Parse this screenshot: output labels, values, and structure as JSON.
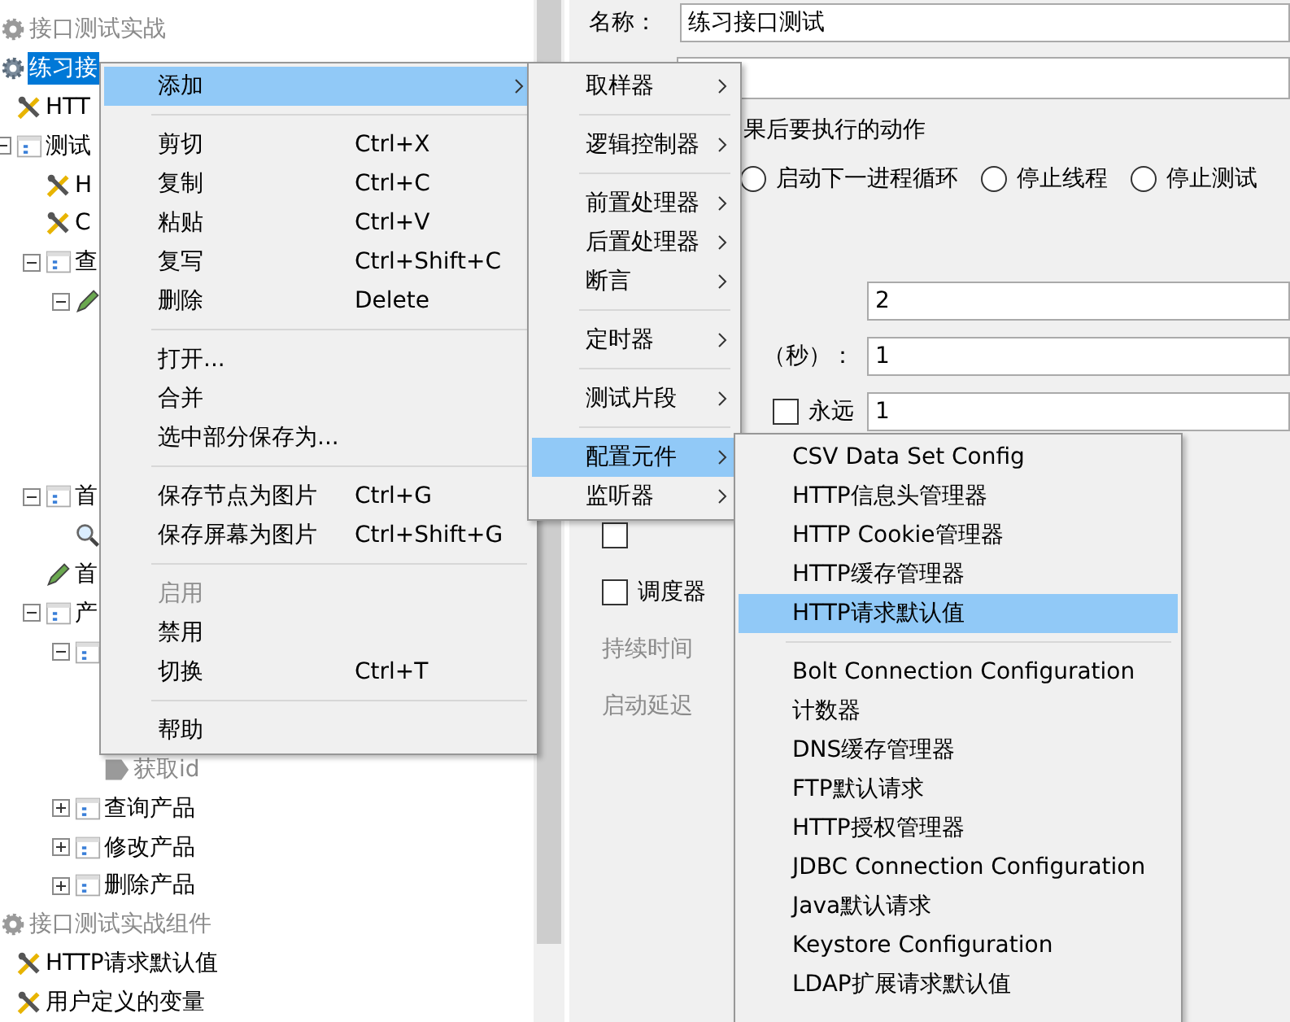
{
  "tree": [
    {
      "label": "接口测试实战",
      "kind": "plan",
      "disabled": true,
      "selected": false
    },
    {
      "label": "练习接",
      "kind": "plan",
      "disabled": false,
      "selected": true,
      "children": [
        {
          "label": "HTT",
          "kind": "config",
          "disabled": false,
          "selected": false
        },
        {
          "label": "测试",
          "kind": "group",
          "disabled": false,
          "selected": false,
          "expanded": true,
          "children": [
            {
              "label": "H",
              "kind": "config",
              "disabled": false,
              "selected": false
            },
            {
              "label": "C",
              "kind": "config",
              "disabled": false,
              "selected": false
            },
            {
              "label": "查",
              "kind": "group",
              "disabled": false,
              "selected": false,
              "expanded": true,
              "children": [
                {
                  "kind": "sampler",
                  "expanded": true
                }
              ]
            },
            {
              "label": "首",
              "kind": "group",
              "disabled": false,
              "selected": false,
              "expanded": true,
              "children": [
                {
                  "kind": "listener"
                }
              ]
            },
            {
              "label": "首",
              "kind": "sampler",
              "disabled": false,
              "selected": false
            },
            {
              "label": "产",
              "kind": "group",
              "disabled": false,
              "selected": false,
              "expanded": true,
              "children": [
                {
                  "kind": "group",
                  "expanded": true,
                  "children": [
                    {
                      "label": "获取id",
                      "kind": "extractor",
                      "disabled": true,
                      "selected": false
                    }
                  ]
                },
                {
                  "label": "查询产品",
                  "kind": "group",
                  "disabled": false,
                  "selected": false,
                  "expanded": false
                },
                {
                  "label": "修改产品",
                  "kind": "group",
                  "disabled": false,
                  "selected": false,
                  "expanded": false
                },
                {
                  "label": "删除产品",
                  "kind": "group",
                  "disabled": false,
                  "selected": false,
                  "expanded": false
                }
              ]
            }
          ]
        }
      ]
    },
    {
      "label": "接口测试实战组件",
      "kind": "plan",
      "disabled": true,
      "selected": false,
      "children": [
        {
          "label": "HTTP请求默认值",
          "kind": "config",
          "disabled": false,
          "selected": false
        },
        {
          "label": "用户定义的变量",
          "kind": "config",
          "disabled": false,
          "selected": false
        }
      ]
    }
  ],
  "editor": {
    "name_label": "名称：",
    "name_value": "练习接口测试",
    "action_group_title": "果后要执行的动作",
    "actions": [
      {
        "label": "启动下一进程循环",
        "selected": false
      },
      {
        "label": "停止线程",
        "selected": false
      },
      {
        "label": "停止测试",
        "selected": false
      }
    ],
    "fields": [
      {
        "value": "2"
      },
      {
        "label": "（秒）：",
        "value": "1"
      },
      {
        "checkbox_label": "永远",
        "checked": false,
        "value": "1"
      }
    ],
    "options": [
      {
        "kind": "checkbox",
        "checked": false
      },
      {
        "kind": "checkbox",
        "label": "调度器",
        "checked": false
      },
      {
        "kind": "text",
        "label": "持续时间",
        "disabled": true
      },
      {
        "kind": "text",
        "label": "启动延迟",
        "disabled": true
      }
    ]
  },
  "context_menu": [
    {
      "kind": "item",
      "label": "添加",
      "selected": true,
      "disabled": false,
      "submenu": true
    },
    {
      "kind": "separator"
    },
    {
      "kind": "item",
      "label": "剪切",
      "shortcut": "Ctrl+X",
      "selected": false,
      "disabled": false,
      "submenu": false
    },
    {
      "kind": "item",
      "label": "复制",
      "shortcut": "Ctrl+C",
      "selected": false,
      "disabled": false,
      "submenu": false
    },
    {
      "kind": "item",
      "label": "粘贴",
      "shortcut": "Ctrl+V",
      "selected": false,
      "disabled": false,
      "submenu": false
    },
    {
      "kind": "item",
      "label": "复写",
      "shortcut": "Ctrl+Shift+C",
      "selected": false,
      "disabled": false,
      "submenu": false
    },
    {
      "kind": "item",
      "label": "删除",
      "shortcut": "Delete",
      "selected": false,
      "disabled": false,
      "submenu": false
    },
    {
      "kind": "separator"
    },
    {
      "kind": "item",
      "label": "打开...",
      "selected": false,
      "disabled": false,
      "submenu": false
    },
    {
      "kind": "item",
      "label": "合并",
      "selected": false,
      "disabled": false,
      "submenu": false
    },
    {
      "kind": "item",
      "label": "选中部分保存为...",
      "selected": false,
      "disabled": false,
      "submenu": false
    },
    {
      "kind": "separator"
    },
    {
      "kind": "item",
      "label": "保存节点为图片",
      "shortcut": "Ctrl+G",
      "selected": false,
      "disabled": false,
      "submenu": false
    },
    {
      "kind": "item",
      "label": "保存屏幕为图片",
      "shortcut": "Ctrl+Shift+G",
      "selected": false,
      "disabled": false,
      "submenu": false
    },
    {
      "kind": "separator"
    },
    {
      "kind": "item",
      "label": "启用",
      "selected": false,
      "disabled": true,
      "submenu": false
    },
    {
      "kind": "item",
      "label": "禁用",
      "selected": false,
      "disabled": false,
      "submenu": false
    },
    {
      "kind": "item",
      "label": "切换",
      "shortcut": "Ctrl+T",
      "selected": false,
      "disabled": false,
      "submenu": false
    },
    {
      "kind": "separator"
    },
    {
      "kind": "item",
      "label": "帮助",
      "selected": false,
      "disabled": false,
      "submenu": false
    }
  ],
  "add_submenu": [
    {
      "kind": "item",
      "label": "取样器",
      "selected": false,
      "disabled": false,
      "submenu": true
    },
    {
      "kind": "separator"
    },
    {
      "kind": "item",
      "label": "逻辑控制器",
      "selected": false,
      "disabled": false,
      "submenu": true
    },
    {
      "kind": "separator"
    },
    {
      "kind": "item",
      "label": "前置处理器",
      "selected": false,
      "disabled": false,
      "submenu": true
    },
    {
      "kind": "item",
      "label": "后置处理器",
      "selected": false,
      "disabled": false,
      "submenu": true
    },
    {
      "kind": "item",
      "label": "断言",
      "selected": false,
      "disabled": false,
      "submenu": true
    },
    {
      "kind": "separator"
    },
    {
      "kind": "item",
      "label": "定时器",
      "selected": false,
      "disabled": false,
      "submenu": true
    },
    {
      "kind": "separator"
    },
    {
      "kind": "item",
      "label": "测试片段",
      "selected": false,
      "disabled": false,
      "submenu": true
    },
    {
      "kind": "separator"
    },
    {
      "kind": "item",
      "label": "配置元件",
      "selected": true,
      "disabled": false,
      "submenu": true
    },
    {
      "kind": "item",
      "label": "监听器",
      "selected": false,
      "disabled": false,
      "submenu": true
    }
  ],
  "config_submenu": [
    {
      "kind": "item",
      "label": "CSV Data Set Config",
      "selected": false,
      "disabled": false,
      "submenu": false
    },
    {
      "kind": "item",
      "label": "HTTP信息头管理器",
      "selected": false,
      "disabled": false,
      "submenu": false
    },
    {
      "kind": "item",
      "label": "HTTP Cookie管理器",
      "selected": false,
      "disabled": false,
      "submenu": false
    },
    {
      "kind": "item",
      "label": "HTTP缓存管理器",
      "selected": false,
      "disabled": false,
      "submenu": false
    },
    {
      "kind": "item",
      "label": "HTTP请求默认值",
      "selected": true,
      "disabled": false,
      "submenu": false
    },
    {
      "kind": "separator"
    },
    {
      "kind": "item",
      "label": "Bolt Connection Configuration",
      "selected": false,
      "disabled": false,
      "submenu": false
    },
    {
      "kind": "item",
      "label": "计数器",
      "selected": false,
      "disabled": false,
      "submenu": false
    },
    {
      "kind": "item",
      "label": "DNS缓存管理器",
      "selected": false,
      "disabled": false,
      "submenu": false
    },
    {
      "kind": "item",
      "label": "FTP默认请求",
      "selected": false,
      "disabled": false,
      "submenu": false
    },
    {
      "kind": "item",
      "label": "HTTP授权管理器",
      "selected": false,
      "disabled": false,
      "submenu": false
    },
    {
      "kind": "item",
      "label": "JDBC Connection Configuration",
      "selected": false,
      "disabled": false,
      "submenu": false
    },
    {
      "kind": "item",
      "label": "Java默认请求",
      "selected": false,
      "disabled": false,
      "submenu": false
    },
    {
      "kind": "item",
      "label": "Keystore Configuration",
      "selected": false,
      "disabled": false,
      "submenu": false
    },
    {
      "kind": "item",
      "label": "LDAP扩展请求默认值",
      "selected": false,
      "disabled": false,
      "submenu": false
    }
  ]
}
